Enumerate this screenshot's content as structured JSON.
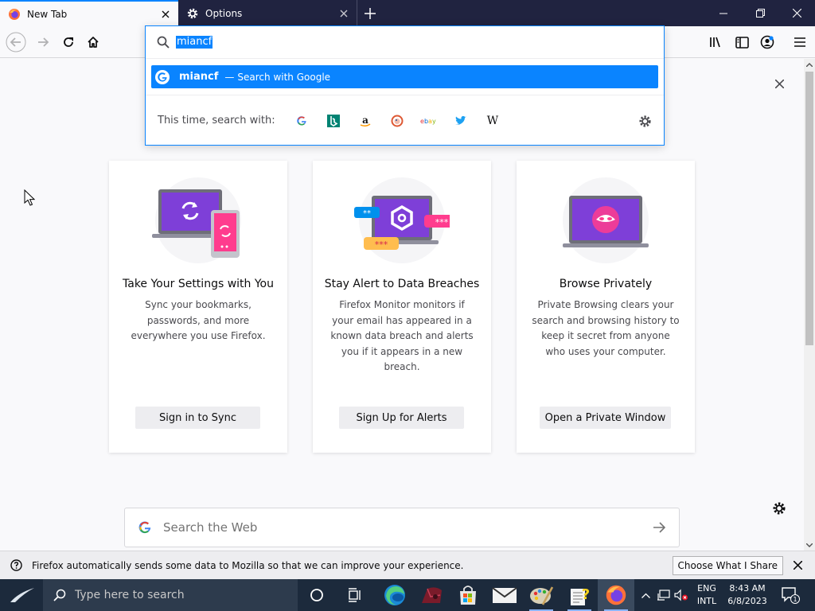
{
  "tabs": [
    {
      "title": "New Tab",
      "icon": "firefox-icon",
      "active": true
    },
    {
      "title": "Options",
      "icon": "gear-icon",
      "active": false
    }
  ],
  "urlbar": {
    "value": "miancf",
    "result": {
      "term": "miancf",
      "separator": "—",
      "action": "Search with Google"
    },
    "oneoff_label": "This time, search with:",
    "engines": [
      "Google",
      "Bing",
      "Amazon",
      "DuckDuckGo",
      "eBay",
      "Twitter",
      "Wikipedia"
    ]
  },
  "cards": [
    {
      "title": "Take Your Settings with You",
      "description": "Sync your bookmarks, passwords, and more everywhere you use Firefox.",
      "button": "Sign in to Sync"
    },
    {
      "title": "Stay Alert to Data Breaches",
      "description": "Firefox Monitor monitors if your email has appeared in a known data breach and alerts you if it appears in a new breach.",
      "button": "Sign Up for Alerts"
    },
    {
      "title": "Browse Privately",
      "description": "Private Browsing clears your search and browsing history to keep it secret from anyone who uses your computer.",
      "button": "Open a Private Window"
    }
  ],
  "search": {
    "placeholder": "Search the Web"
  },
  "notification": {
    "text": "Firefox automatically sends some data to Mozilla so that we can improve your experience.",
    "button": "Choose What I Share"
  },
  "taskbar": {
    "search_placeholder": "Type here to search",
    "language": {
      "line1": "ENG",
      "line2": "INTL"
    },
    "clock": {
      "time": "8:43 AM",
      "date": "6/8/2023"
    },
    "notification_count": "1"
  },
  "colors": {
    "accent": "#0a84ff",
    "tab_strip": "#202340",
    "taskbar": "#1c2a3c"
  }
}
